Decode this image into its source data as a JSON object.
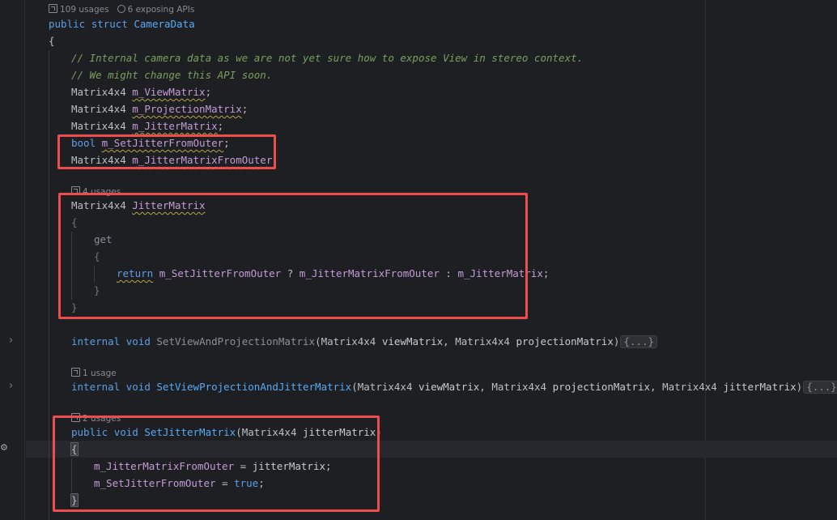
{
  "hints": {
    "struct_usages": "109 usages",
    "struct_apis": "6 exposing APIs",
    "jitter_usages": "4 usages",
    "setviewproj_usages": "1 usage",
    "setjitter_usages": "2 usages"
  },
  "code": {
    "kw_public": "public",
    "kw_struct": "struct",
    "struct_name": "CameraData",
    "open_brace": "{",
    "close_brace": "}",
    "comment1": "// Internal camera data as we are not yet sure how to expose View in stereo context.",
    "comment2": "// We might change this API soon.",
    "type_matrix": "Matrix4x4",
    "type_bool": "bool",
    "f_view": "m_ViewMatrix",
    "f_proj": "m_ProjectionMatrix",
    "f_jitter": "m_JitterMatrix",
    "f_setjitter": "m_SetJitterFromOuter",
    "f_jitterouter": "m_JitterMatrixFromOuter",
    "semi": ";",
    "prop_name": "JitterMatrix",
    "kw_get": "get",
    "kw_return": "return",
    "ternary_q": "?",
    "ternary_c": ":",
    "kw_internal": "internal",
    "kw_void": "void",
    "m_setviewandproj": "SetViewAndProjectionMatrix",
    "m_setviewprojjitter": "SetViewProjectionAndJitterMatrix",
    "m_setjitter": "SetJitterMatrix",
    "p_view": "viewMatrix",
    "p_proj": "projectionMatrix",
    "p_jitter": "jitterMatrix",
    "folded": "{...}",
    "kw_true": "true",
    "assign": "="
  },
  "colors": {
    "annotation_box": "#ee4d4d",
    "background": "#1e1f22"
  }
}
